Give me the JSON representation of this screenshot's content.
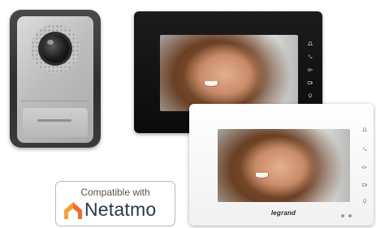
{
  "badge": {
    "caption": "Compatible with",
    "brand": "Netatmo",
    "logo_icon": "netatmo-house-logo",
    "brand_color": "#2a3a4a",
    "logo_color": "#f26a2e"
  },
  "monitor_white": {
    "brand": "legrand",
    "touch_keys": [
      "bell-icon",
      "phone-icon",
      "key-icon",
      "camera-icon",
      "light-icon"
    ]
  },
  "monitor_black": {
    "touch_keys": [
      "bell-icon",
      "phone-icon",
      "key-icon",
      "camera-icon",
      "light-icon"
    ]
  },
  "door_station": {
    "icons": [
      "camera-lens-icon",
      "call-button-icon"
    ]
  }
}
